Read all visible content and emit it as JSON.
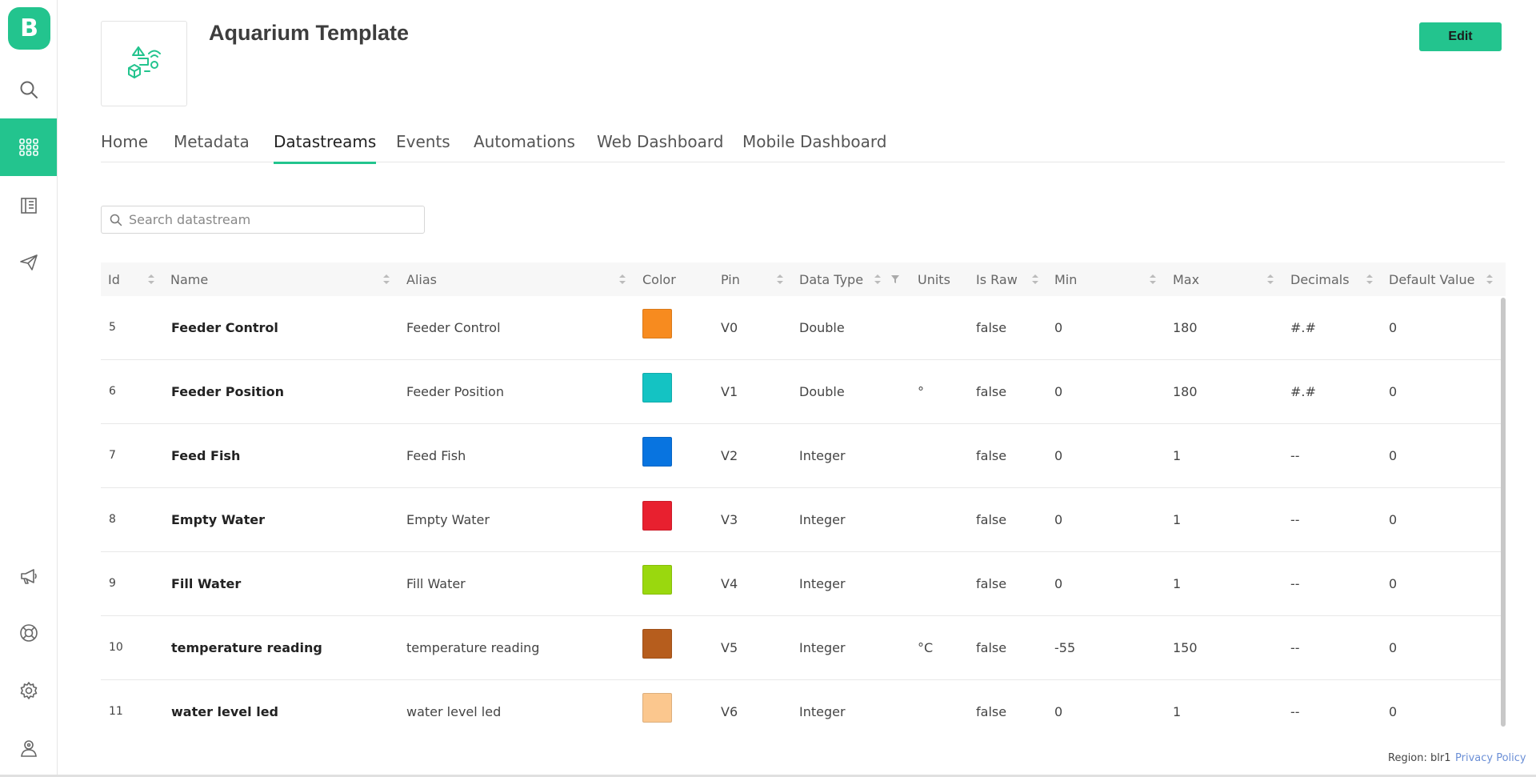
{
  "brand": {
    "logo_letter": "B",
    "accent_color": "#23c48e"
  },
  "sidebar": {
    "items": [
      {
        "icon": "search-icon"
      },
      {
        "icon": "grid-icon",
        "active": true
      },
      {
        "icon": "building-icon"
      },
      {
        "icon": "send-icon"
      },
      {
        "icon": "megaphone-icon"
      },
      {
        "icon": "lifebuoy-icon"
      },
      {
        "icon": "gear-icon"
      },
      {
        "icon": "user-icon"
      }
    ]
  },
  "header": {
    "title": "Aquarium Template",
    "edit_label": "Edit"
  },
  "tabs": [
    {
      "label": "Home"
    },
    {
      "label": "Metadata"
    },
    {
      "label": "Datastreams",
      "active": true
    },
    {
      "label": "Events"
    },
    {
      "label": "Automations"
    },
    {
      "label": "Web Dashboard"
    },
    {
      "label": "Mobile Dashboard"
    }
  ],
  "search": {
    "placeholder": "Search datastream",
    "value": ""
  },
  "table": {
    "columns": [
      "Id",
      "Name",
      "Alias",
      "Color",
      "Pin",
      "Data Type",
      "Units",
      "Is Raw",
      "Min",
      "Max",
      "Decimals",
      "Default Value"
    ],
    "rows": [
      {
        "id": "5",
        "name": "Feeder Control",
        "alias": "Feeder Control",
        "color": "#f78b1f",
        "pin": "V0",
        "type": "Double",
        "units": "",
        "raw": "false",
        "min": "0",
        "max": "180",
        "decimals": "#.#",
        "default": "0"
      },
      {
        "id": "6",
        "name": "Feeder Position",
        "alias": "Feeder Position",
        "color": "#14c3c3",
        "pin": "V1",
        "type": "Double",
        "units": "°",
        "raw": "false",
        "min": "0",
        "max": "180",
        "decimals": "#.#",
        "default": "0"
      },
      {
        "id": "7",
        "name": "Feed Fish",
        "alias": "Feed Fish",
        "color": "#0874e0",
        "pin": "V2",
        "type": "Integer",
        "units": "",
        "raw": "false",
        "min": "0",
        "max": "1",
        "decimals": "--",
        "default": "0"
      },
      {
        "id": "8",
        "name": "Empty Water",
        "alias": "Empty Water",
        "color": "#e8202f",
        "pin": "V3",
        "type": "Integer",
        "units": "",
        "raw": "false",
        "min": "0",
        "max": "1",
        "decimals": "--",
        "default": "0"
      },
      {
        "id": "9",
        "name": "Fill Water",
        "alias": "Fill Water",
        "color": "#9ad80e",
        "pin": "V4",
        "type": "Integer",
        "units": "",
        "raw": "false",
        "min": "0",
        "max": "1",
        "decimals": "--",
        "default": "0"
      },
      {
        "id": "10",
        "name": "temperature reading",
        "alias": "temperature reading",
        "color": "#b65d1d",
        "pin": "V5",
        "type": "Integer",
        "units": "°C",
        "raw": "false",
        "min": "-55",
        "max": "150",
        "decimals": "--",
        "default": "0"
      },
      {
        "id": "11",
        "name": "water level led",
        "alias": "water level led",
        "color": "#fbc78e",
        "pin": "V6",
        "type": "Integer",
        "units": "",
        "raw": "false",
        "min": "0",
        "max": "1",
        "decimals": "--",
        "default": "0"
      }
    ]
  },
  "footer": {
    "region": "Region: blr1",
    "privacy": "Privacy Policy"
  }
}
